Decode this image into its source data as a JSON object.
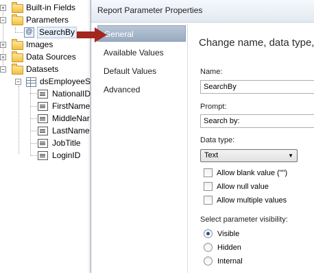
{
  "tree": {
    "builtin_fields": "Built-in Fields",
    "parameters": "Parameters",
    "search_by": "SearchBy",
    "images": "Images",
    "data_sources": "Data Sources",
    "datasets": "Datasets",
    "dataset_name": "dsEmployeeSe",
    "fields": [
      "NationalID",
      "FirstName",
      "MiddleNar",
      "LastName",
      "JobTitle",
      "LoginID"
    ]
  },
  "dialog": {
    "title": "Report Parameter Properties",
    "nav": [
      "General",
      "Available Values",
      "Default Values",
      "Advanced"
    ],
    "heading": "Change name, data type,",
    "name_label": "Name:",
    "name_value": "SearchBy",
    "prompt_label": "Prompt:",
    "prompt_value": "Search by:",
    "datatype_label": "Data type:",
    "datatype_value": "Text",
    "allow_blank": "Allow blank value (\"\")",
    "allow_null": "Allow null value",
    "allow_multiple": "Allow multiple values",
    "visibility_label": "Select parameter visibility:",
    "visibility_options": [
      "Visible",
      "Hidden",
      "Internal"
    ],
    "visibility_selected": "Visible"
  },
  "colors": {
    "annotation_arrow": "#a3261f",
    "nav_active": "#a8b8cc"
  },
  "icons": [
    "folder-icon",
    "parameter-icon",
    "dataset-icon",
    "field-icon",
    "expand-icon",
    "collapse-icon",
    "dropdown-arrow-icon"
  ]
}
